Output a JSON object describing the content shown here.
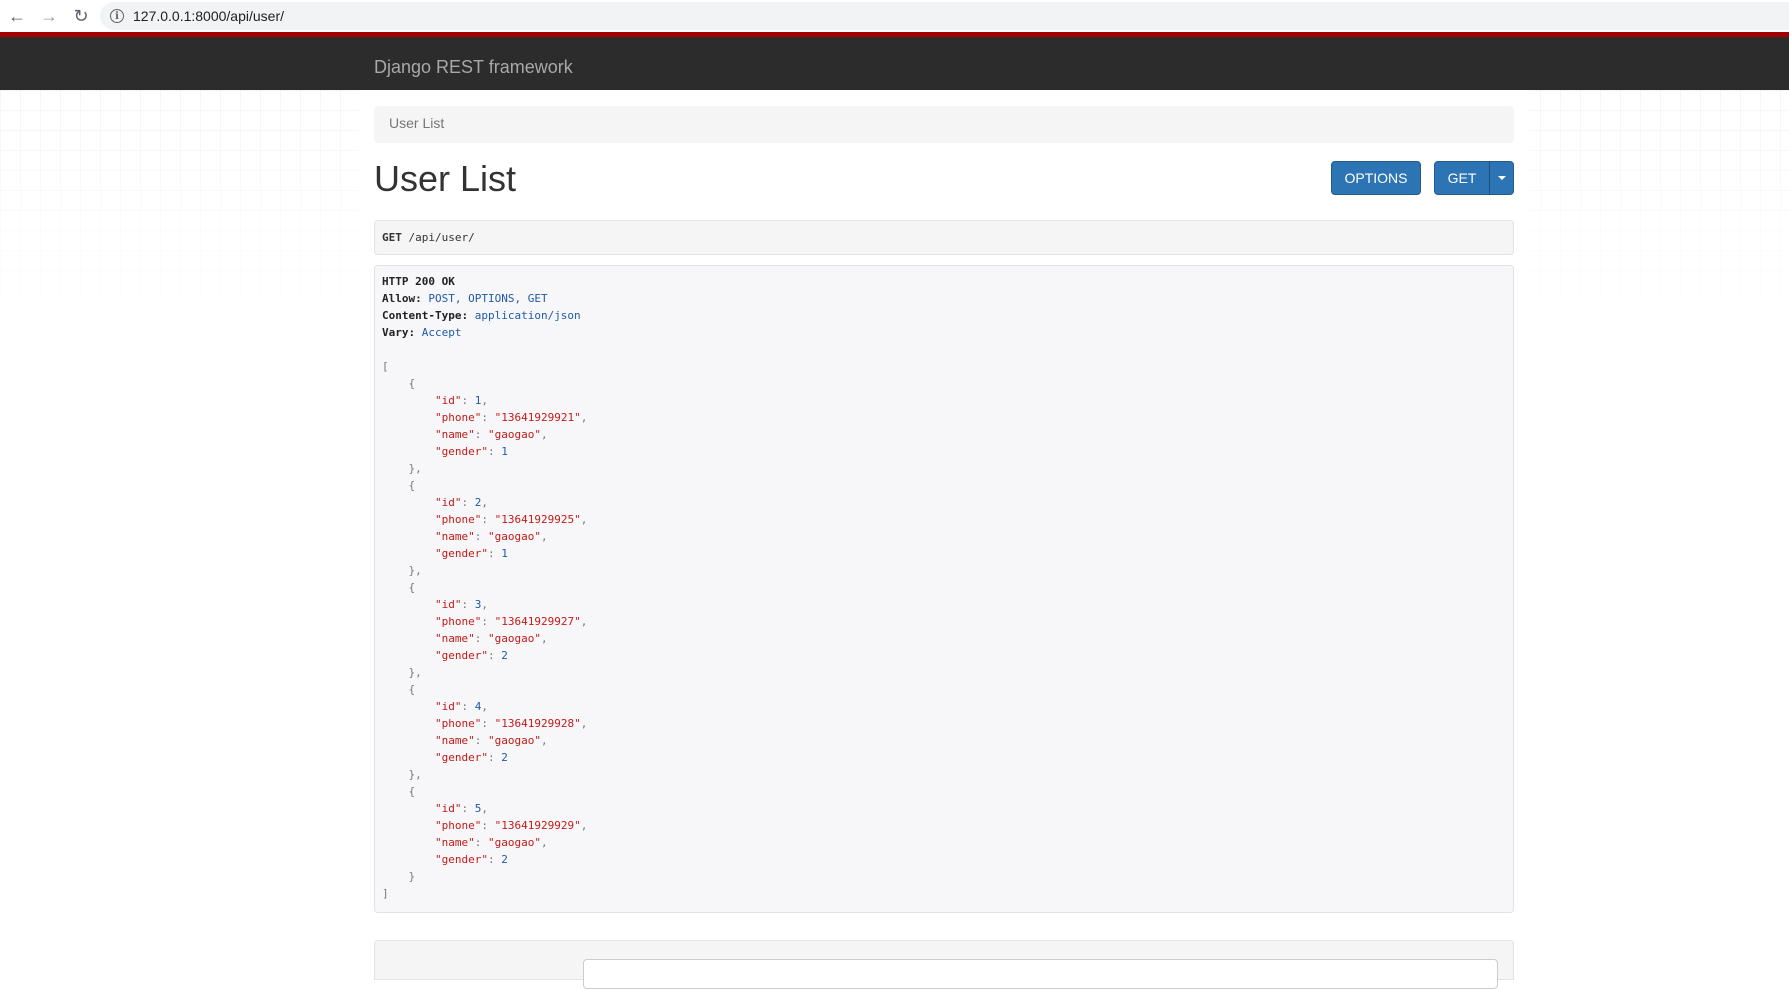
{
  "browser": {
    "url": "127.0.0.1:8000/api/user/"
  },
  "navbar": {
    "brand": "Django REST framework"
  },
  "breadcrumb": {
    "current": "User List"
  },
  "page": {
    "title": "User List",
    "options_label": "OPTIONS",
    "get_label": "GET"
  },
  "request": {
    "method": "GET",
    "path": "/api/user/"
  },
  "response": {
    "status": "HTTP 200 OK",
    "headers": [
      {
        "key": "Allow:",
        "value": "POST, OPTIONS, GET"
      },
      {
        "key": "Content-Type:",
        "value": "application/json"
      },
      {
        "key": "Vary:",
        "value": "Accept"
      }
    ],
    "users": [
      {
        "id": "1",
        "phone": "\"13641929921\"",
        "name": "\"gaogao\"",
        "gender": "1"
      },
      {
        "id": "2",
        "phone": "\"13641929925\"",
        "name": "\"gaogao\"",
        "gender": "1"
      },
      {
        "id": "3",
        "phone": "\"13641929927\"",
        "name": "\"gaogao\"",
        "gender": "2"
      },
      {
        "id": "4",
        "phone": "\"13641929928\"",
        "name": "\"gaogao\"",
        "gender": "2"
      },
      {
        "id": "5",
        "phone": "\"13641929929\"",
        "name": "\"gaogao\"",
        "gender": "2"
      }
    ]
  },
  "json_keys": {
    "id": "\"id\"",
    "phone": "\"phone\"",
    "name": "\"name\"",
    "gender": "\"gender\""
  },
  "colors": {
    "navbar_bg": "#2c2c2c",
    "navbar_accent": "#a30000",
    "button_primary": "#2c74b4"
  }
}
